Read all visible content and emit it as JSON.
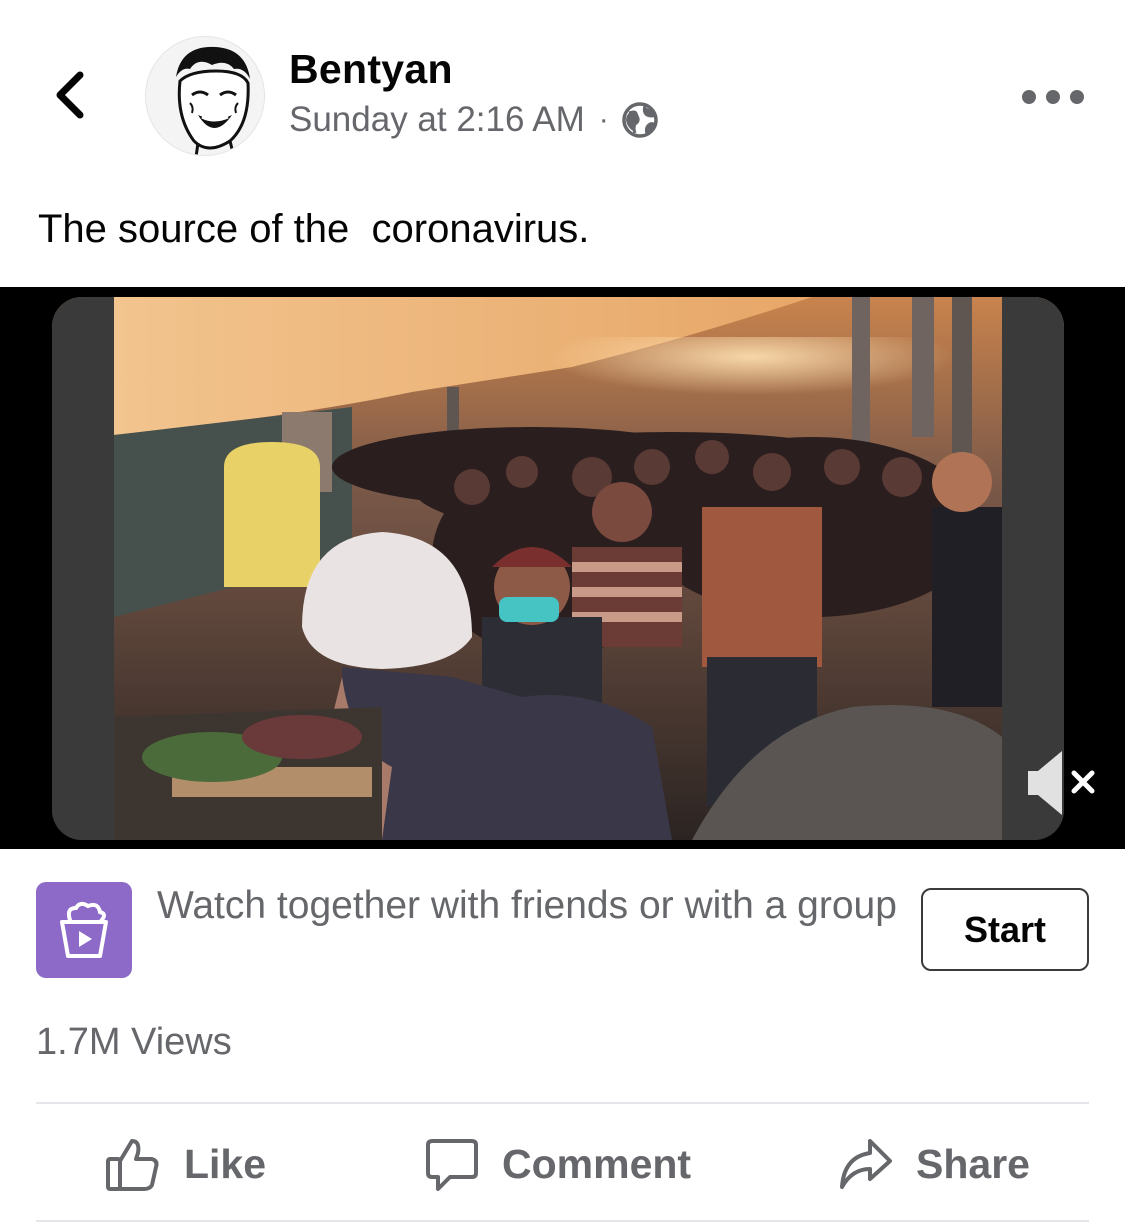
{
  "post": {
    "author": "Bentyan",
    "timestamp": "Sunday at 2:16 AM",
    "separator": "·",
    "text": "The source of the  coronavirus."
  },
  "icons": {
    "back": "chevron-left-icon",
    "more": "more-horizontal-icon",
    "privacy": "globe-icon",
    "mute": "speaker-muted-icon",
    "watch_party": "popcorn-play-icon",
    "like": "thumbs-up-icon",
    "comment": "speech-bubble-icon",
    "share": "share-arrow-icon"
  },
  "watch_party": {
    "text": "Watch together with friends or with a group",
    "button_label": "Start",
    "icon_color": "#8d6ac8"
  },
  "stats": {
    "views": "1.7M Views"
  },
  "actions": {
    "like": "Like",
    "comment": "Comment",
    "share": "Share"
  },
  "colors": {
    "primary_text": "#050505",
    "secondary_text": "#65676b",
    "divider": "#e4e6eb"
  }
}
